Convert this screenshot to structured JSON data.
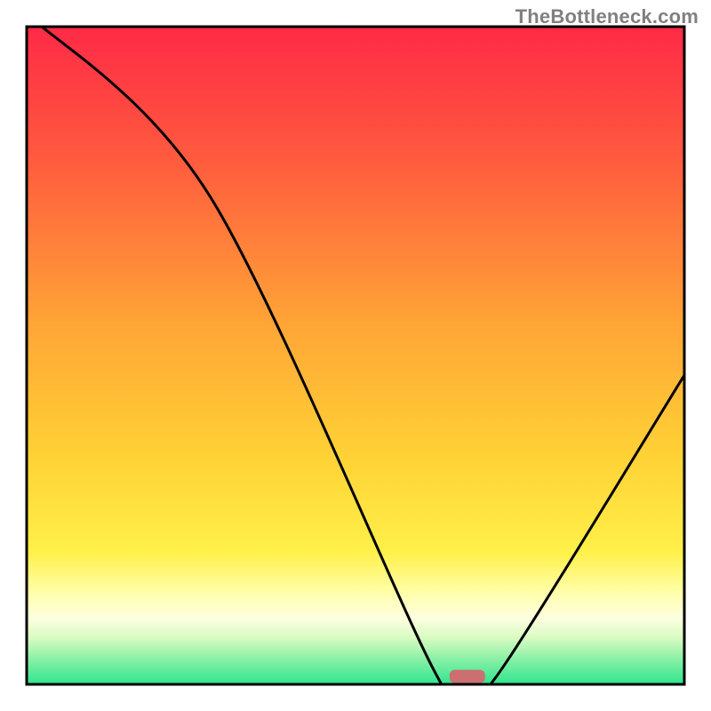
{
  "watermark": "TheBottleneck.com",
  "chart_data": {
    "type": "line",
    "title": "",
    "xlabel": "",
    "ylabel": "",
    "xlim": [
      0,
      100
    ],
    "ylim": [
      0,
      100
    ],
    "x": [
      0,
      28,
      62,
      67,
      72,
      100
    ],
    "values": [
      102,
      74,
      2,
      0,
      2,
      47
    ],
    "annotations": [
      {
        "type": "marker",
        "shape": "rounded-rect",
        "x": 67,
        "y": 1.2,
        "color": "#cb6f70"
      }
    ],
    "background_gradient": {
      "stops": [
        {
          "offset": 0.0,
          "color": "#ff2a47"
        },
        {
          "offset": 0.2,
          "color": "#ff5a3e"
        },
        {
          "offset": 0.45,
          "color": "#ffa436"
        },
        {
          "offset": 0.65,
          "color": "#ffd135"
        },
        {
          "offset": 0.8,
          "color": "#fff04a"
        },
        {
          "offset": 0.86,
          "color": "#ffffaa"
        },
        {
          "offset": 0.9,
          "color": "#fdffe0"
        },
        {
          "offset": 0.93,
          "color": "#d7fbc1"
        },
        {
          "offset": 0.96,
          "color": "#8df1a7"
        },
        {
          "offset": 1.0,
          "color": "#2fe58e"
        }
      ]
    },
    "frame_color": "#000000",
    "line_color": "#000000",
    "line_width": 3
  }
}
